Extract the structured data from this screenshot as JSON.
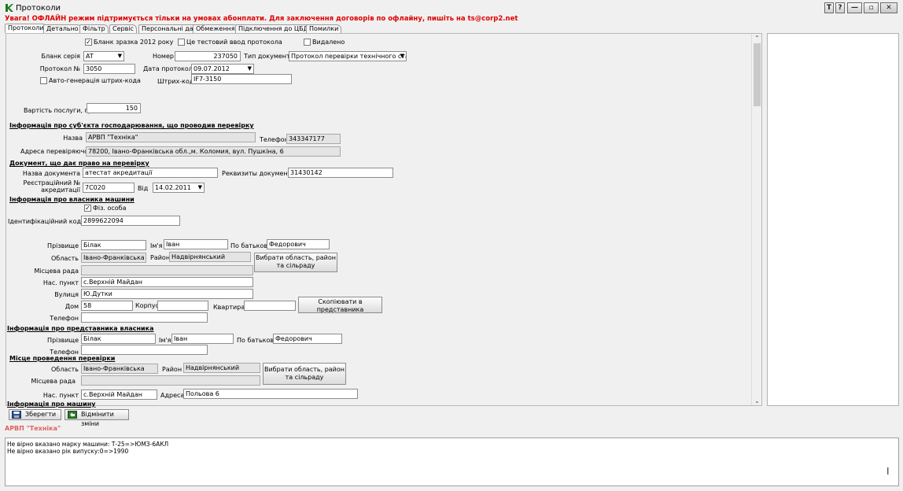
{
  "window": {
    "title": "Протоколи",
    "buttons": [
      "T",
      "?"
    ]
  },
  "warning": "Увага! ОФЛАЙН режим підтримується тільки на умовах абонплати. Для заключення договорів по офлайну, пишіть на ts@corp2.net",
  "tabs": [
    "Протоколи",
    "Детально",
    "Фільтр",
    "Сервіс",
    "Персональні дані",
    "Обмеження",
    "Підключення до ЦБД",
    "Помилки"
  ],
  "header": {
    "blank2012": "Бланк зразка 2012 року",
    "testInput": "Це тестовий ввод протокола",
    "deleted": "Видалено",
    "blankSeriesLabel": "Бланк серія",
    "blankSeries": "AT",
    "numberLabel": "Номер",
    "number": "237050",
    "docTypeLabel": "Тип документа",
    "docType": "Протокол перевірки технічного стану",
    "protocolNoLabel": "Протокол №",
    "protocolNo": "3050",
    "protocolDateLabel": "Дата протокола",
    "protocolDate": "09.07.2012",
    "autoBarcode": "Авто-генерація штрих-кода",
    "barcodeLabel": "Штрих-код",
    "barcode": "IF7-3150",
    "priceLabel": "Вартість послуги, грн",
    "price": "150"
  },
  "inspector": {
    "section": "Інформація про суб'єкта господарювання, що проводив перевірку",
    "nameLabel": "Назва",
    "name": "АРВП \"Техніка\"",
    "phoneLabel": "Телефон",
    "phone": "343347177",
    "addressLabel": "Адреса перевіряючого",
    "address": "78200, Івано-Франківська обл.,м. Коломия, вул. Пушкіна, 6"
  },
  "document": {
    "section": "Документ, що дає право на перевірку",
    "docNameLabel": "Назва документа",
    "docName": "атестат акредитації",
    "detailsLabel": "Реквизиты документа",
    "details": "31430142",
    "regNoLabel1": "Реєстраційний №",
    "regNoLabel2": "акредитації",
    "regNo": "7С020",
    "fromLabel": "Від",
    "fromDate": "14.02.2011"
  },
  "owner": {
    "section": "Інформація про власника машини",
    "person": "Фіз. особа",
    "idCodeLabel": "Ідентифікаційний код",
    "idCode": "2899622094",
    "surnameLabel": "Прізвище",
    "surname": "Білак",
    "nameLabel": "Ім'я",
    "name": "Іван",
    "patronymicLabel": "По батькові",
    "patronymic": "Федорович",
    "regionLabel": "Область",
    "region": "Івано-Франківська",
    "districtLabel": "Район",
    "district": "Надвірнянський",
    "chooseButton": "Вибрати область, район та сільраду",
    "councilLabel": "Місцева рада",
    "council": "",
    "settlementLabel": "Нас. пункт",
    "settlement": "с.Верхній Майдан",
    "streetLabel": "Вулиця",
    "street": "Ю.Дутки",
    "houseLabel": "Дом",
    "house": "58",
    "buildingLabel": "Корпус",
    "building": "",
    "flatLabel": "Квартира",
    "flat": "",
    "copyButton": "Скопіювати в представника",
    "phoneLabel": "Телефон",
    "phone": ""
  },
  "representative": {
    "section": "Інформація про представника власника",
    "surnameLabel": "Прізвище",
    "surname": "Білак",
    "nameLabel": "Ім'я",
    "name": "Іван",
    "patronymicLabel": "По батькові",
    "patronymic": "Федорович",
    "phoneLabel": "Телефон",
    "phone": ""
  },
  "place": {
    "section": "Місце проведення перевірки",
    "regionLabel": "Область",
    "region": "Івано-Франківська",
    "districtLabel": "Район",
    "district": "Надвірнянський",
    "chooseButton": "Вибрати область, район та сільраду",
    "councilLabel": "Місцева рада",
    "council": "",
    "settlementLabel": "Нас. пункт",
    "settlement": "с.Верхній Майдан",
    "addressLabel": "Адреса",
    "address": "Польова 6"
  },
  "machine": {
    "section": "Інформація про машину"
  },
  "toolbar": {
    "save": "Зберегти",
    "cancel": "Відмінити зміни"
  },
  "status": {
    "org": "АРВП \"Техніка\""
  },
  "log": [
    "Не вірно вказано марку машини: Т-25=>ЮМЗ-6АКЛ",
    "Не вірно вказано рік випуску:0=>1990"
  ],
  "colors": {
    "warning": "#e00000",
    "status": "#e06060",
    "appIcon": "#1a7a1a"
  }
}
